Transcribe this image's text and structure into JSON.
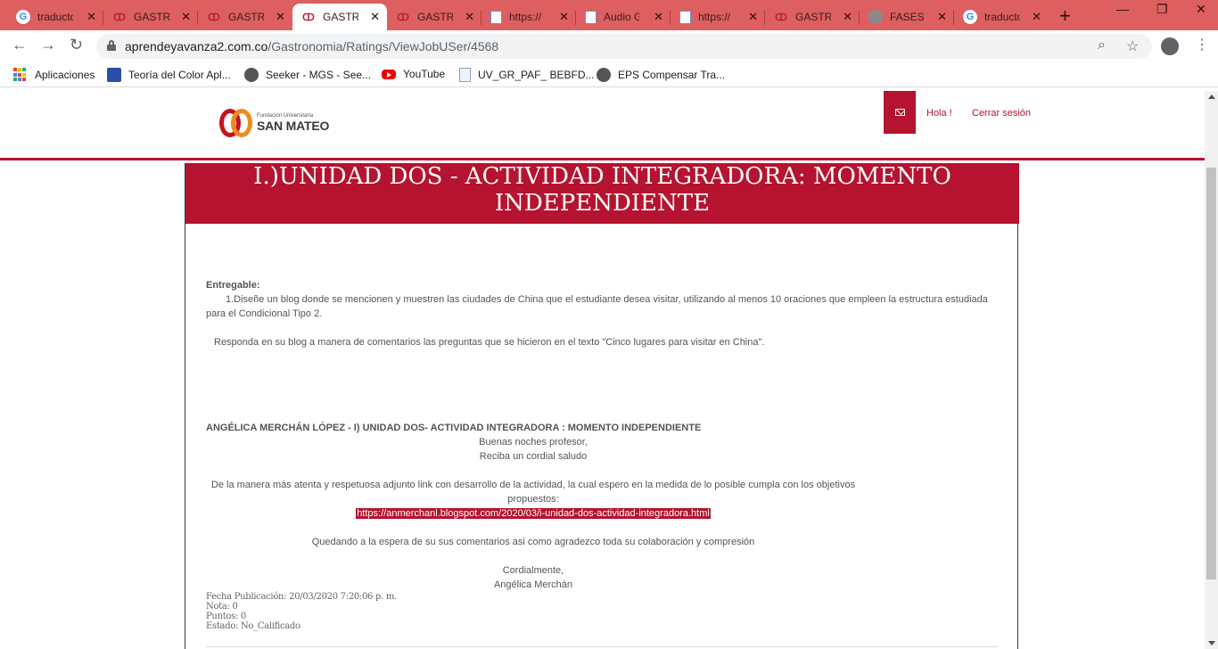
{
  "browser": {
    "tabs": [
      {
        "title": "traductor",
        "icon": "google-icon"
      },
      {
        "title": "GASTRONOMIA",
        "icon": "san-mateo-icon"
      },
      {
        "title": "GASTRONOMIA",
        "icon": "san-mateo-icon"
      },
      {
        "title": "GASTRONOMIA",
        "icon": "san-mateo-icon",
        "active": true
      },
      {
        "title": "GASTRONOMIA",
        "icon": "san-mateo-icon"
      },
      {
        "title": "https://",
        "icon": "document-icon"
      },
      {
        "title": "Audio G",
        "icon": "document-icon"
      },
      {
        "title": "https://",
        "icon": "document-icon"
      },
      {
        "title": "GASTRONOMIA",
        "icon": "san-mateo-icon"
      },
      {
        "title": "FASES C",
        "icon": "globe-icon"
      },
      {
        "title": "traductor",
        "icon": "google-icon"
      }
    ],
    "url_host": "aprendeyavanza2.com.co",
    "url_path": "/Gastronomia/Ratings/ViewJobUSer/4568",
    "bookmarks": [
      {
        "label": "Aplicaciones",
        "icon": "apps-grid-icon"
      },
      {
        "label": "Teoría del Color Apl...",
        "icon": "book-icon"
      },
      {
        "label": "Seeker - MGS - See...",
        "icon": "globe-icon"
      },
      {
        "label": "YouTube",
        "icon": "youtube-icon"
      },
      {
        "label": "UV_GR_PAF_ BEBFD...",
        "icon": "document-icon"
      },
      {
        "label": "EPS Compensar Tra...",
        "icon": "globe-icon"
      }
    ]
  },
  "header": {
    "logo_small": "Fundación Universitaria",
    "logo_main": "SAN MATEO",
    "greeting": "Hola !",
    "logout": "Cerrar sesión"
  },
  "activity": {
    "title_line1": "I.)UNIDAD DOS - ACTIVIDAD INTEGRADORA: MOMENTO",
    "title_line2": "INDEPENDIENTE",
    "deliverable_label": "Entregable:",
    "deliverable_item": "1.Diseñe un blog donde se mencionen y muestren las ciudades de China que el estudiante desea visitar, utilizando al menos 10 oraciones que empleen la estructura estudiada para el Condicional Tipo 2.",
    "deliverable_note": "Responda en su blog a manera de comentarios las preguntas que se hicieron en el texto \"Cinco lugares para visitar en China\"."
  },
  "submission": {
    "heading": "ANGÉLICA MERCHÁN LÓPEZ - I) UNIDAD DOS- ACTIVIDAD INTEGRADORA : MOMENTO INDEPENDIENTE",
    "greeting1": "Buenas noches profesor,",
    "greeting2": "Reciba un cordial saludo",
    "body_line1": "De la manera más atenta y respetuosa adjunto link con desarrollo de la actividad, la cual espero en la medida de lo posible cumpla con los objetivos",
    "body_line2": "propuestos:",
    "link": "https://anmerchanl.blogspot.com/2020/03/i-unidad-dos-actividad-integradora.html",
    "closing_text": "Quedando a la espera de su sus comentarios asi como agradezco toda su colaboración y compresión",
    "signoff": "Cordialmente,",
    "signature": "Angélica Merchán",
    "fecha": "Fecha Publicación: 20/03/2020 7:20:06 p. m.",
    "nota": "Nota: 0",
    "puntos": "Puntos: 0",
    "estado": "Estado: No_Calificado"
  },
  "colors": {
    "brand": "#b5132f",
    "tabbar": "#de5f5f"
  }
}
